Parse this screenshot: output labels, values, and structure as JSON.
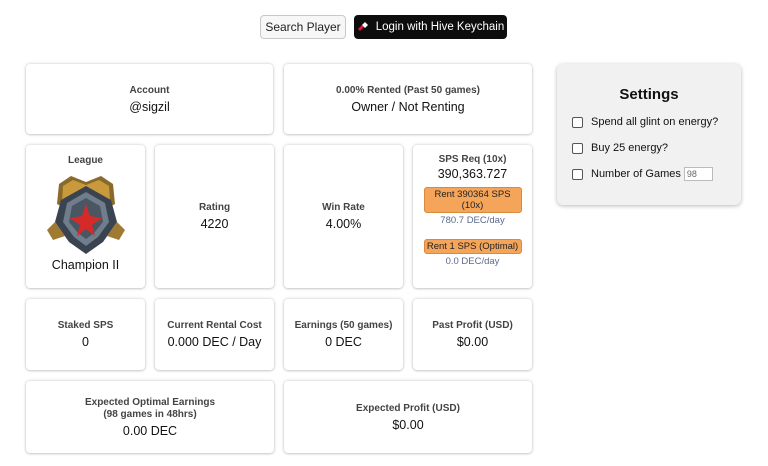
{
  "topbar": {
    "search_label": "Search Player",
    "login_label": "Login with Hive Keychain"
  },
  "account": {
    "label": "Account",
    "value": "@sigzil"
  },
  "rented": {
    "label": "0.00% Rented (Past 50 games)",
    "value": "Owner / Not Renting"
  },
  "league": {
    "label": "League",
    "value": "Champion II",
    "badge_icon": "champion-league-badge-icon"
  },
  "rating": {
    "label": "Rating",
    "value": "4220"
  },
  "win_rate": {
    "label": "Win Rate",
    "value": "4.00%"
  },
  "sps_req": {
    "label": "SPS Req (10x)",
    "value": "390,363.727",
    "rent_10x_label": "Rent 390364 SPS (10x)",
    "rent_10x_cost": "780.7 DEC/day",
    "rent_1_label": "Rent 1 SPS (Optimal)",
    "rent_1_cost": "0.0 DEC/day",
    "button_color": "#f5a55a"
  },
  "staked": {
    "label": "Staked SPS",
    "value": "0"
  },
  "rental_cost": {
    "label": "Current Rental Cost",
    "value": "0.000 DEC / Day"
  },
  "earnings": {
    "label": "Earnings (50 games)",
    "value": "0 DEC"
  },
  "past_profit": {
    "label": "Past Profit (USD)",
    "value": "$0.00"
  },
  "expected_earnings": {
    "label_line1": "Expected Optimal Earnings",
    "label_line2": "(98 games in 48hrs)",
    "value": "0.00 DEC"
  },
  "expected_profit": {
    "label": "Expected Profit (USD)",
    "value": "$0.00"
  },
  "settings": {
    "title": "Settings",
    "opt_glint": "Spend all glint on energy?",
    "opt_energy": "Buy 25 energy?",
    "opt_games": "Number of Games",
    "games_value": "98"
  }
}
